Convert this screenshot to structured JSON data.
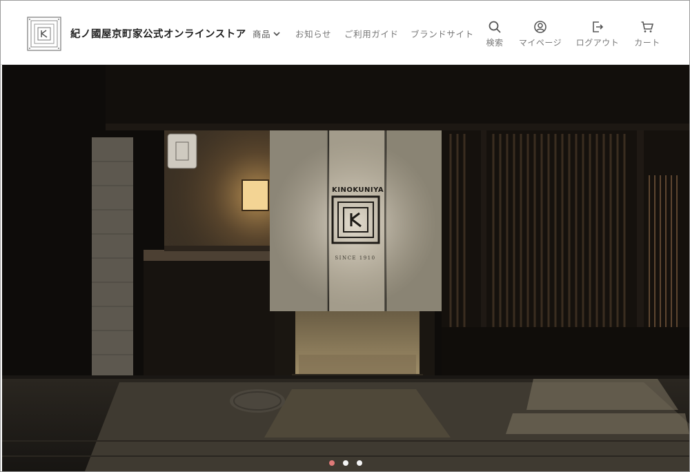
{
  "header": {
    "site_title": "紀ノ國屋京町家公式オンラインストア",
    "logo_text": "KINOKUNIYA"
  },
  "nav": {
    "products": "商品",
    "news": "お知らせ",
    "guide": "ご利用ガイド",
    "brand": "ブランドサイト"
  },
  "utilities": {
    "search": "検索",
    "mypage": "マイページ",
    "logout": "ログアウト",
    "cart": "カート"
  },
  "hero": {
    "noren_text": "KINOKUNIYA",
    "noren_sub": "SINCE 1910",
    "slides_count": 3,
    "active_slide": 1
  },
  "colors": {
    "accent_dot": "#e07a78",
    "header_bg": "#ffffff",
    "text_nav": "#777777"
  }
}
